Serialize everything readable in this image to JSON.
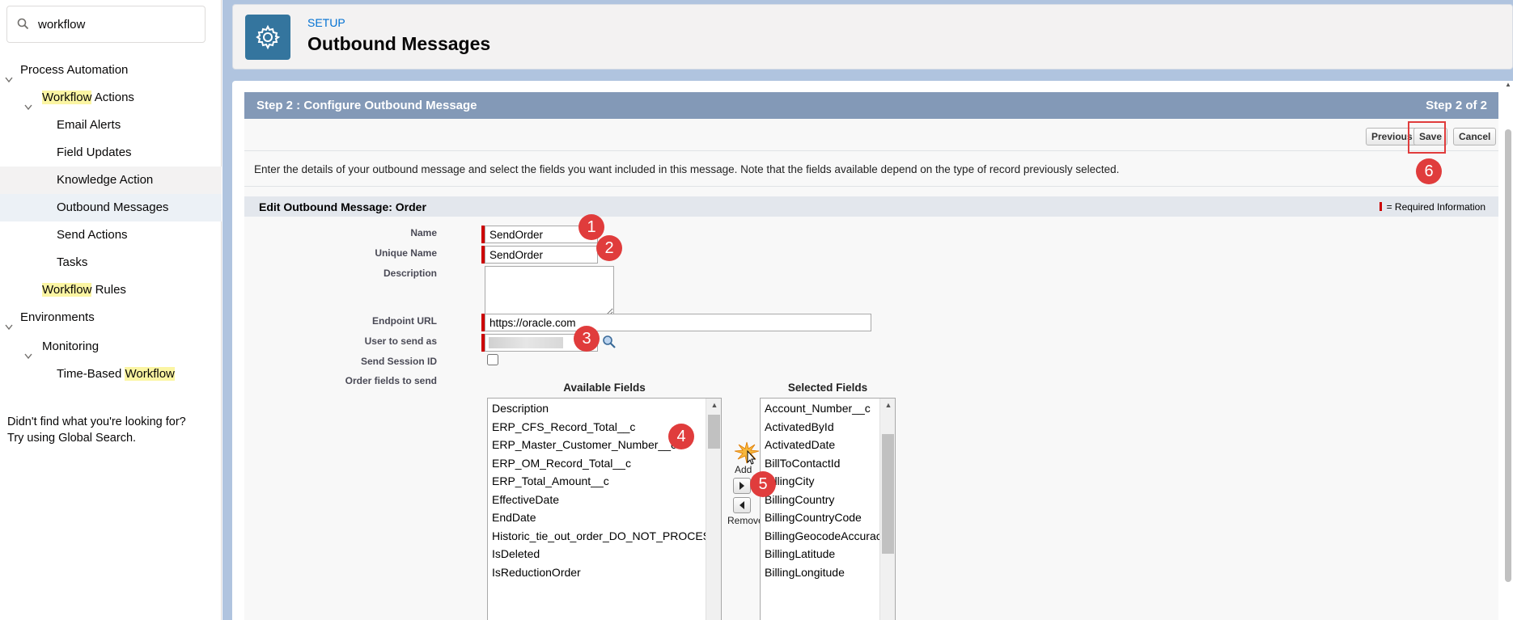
{
  "sidebar": {
    "search": {
      "value": "workflow"
    },
    "tree": [
      {
        "pre": "",
        "hl": "",
        "post": "Process Automation"
      },
      {
        "pre": "",
        "hl": "Workflow",
        "post": " Actions"
      },
      {
        "pre": "Email Alerts",
        "hl": "",
        "post": ""
      },
      {
        "pre": "Field Updates",
        "hl": "",
        "post": ""
      },
      {
        "pre": "Knowledge Action",
        "hl": "",
        "post": ""
      },
      {
        "pre": "Outbound Messages",
        "hl": "",
        "post": ""
      },
      {
        "pre": "Send Actions",
        "hl": "",
        "post": ""
      },
      {
        "pre": "Tasks",
        "hl": "",
        "post": ""
      },
      {
        "pre": "",
        "hl": "Workflow",
        "post": " Rules"
      },
      {
        "pre": "Environments",
        "hl": "",
        "post": ""
      },
      {
        "pre": "Monitoring",
        "hl": "",
        "post": ""
      },
      {
        "pre": "Time-Based ",
        "hl": "Workflow",
        "post": ""
      }
    ],
    "help_line1": "Didn't find what you're looking for?",
    "help_line2": "Try using Global Search."
  },
  "header": {
    "eyebrow": "SETUP",
    "title": "Outbound Messages",
    "icon": "gear-icon"
  },
  "step": {
    "title": "Step 2 : Configure Outbound Message",
    "count": "Step 2 of 2"
  },
  "buttons": {
    "previous": "Previous",
    "save": "Save",
    "cancel": "Cancel"
  },
  "intro": "Enter the details of your outbound message and select the fields you want included in this message. Note that the fields available depend on the type of record previously selected.",
  "section": {
    "title": "Edit Outbound Message: Order",
    "required_legend": "= Required Information"
  },
  "form": {
    "name_label": "Name",
    "name_value": "SendOrder",
    "unique_label": "Unique Name",
    "unique_value": "SendOrder",
    "description_label": "Description",
    "description_value": "",
    "endpoint_label": "Endpoint URL",
    "endpoint_value": "https://oracle.com",
    "user_label": "User to send as",
    "session_label": "Send Session ID",
    "fields_label": "Order fields to send"
  },
  "available": {
    "title": "Available Fields",
    "items": [
      "Description",
      "ERP_CFS_Record_Total__c",
      "ERP_Master_Customer_Number__c",
      "ERP_OM_Record_Total__c",
      "ERP_Total_Amount__c",
      "EffectiveDate",
      "EndDate",
      "Historic_tie_out_order_DO_NOT_PROCESS__c",
      "IsDeleted",
      "IsReductionOrder"
    ]
  },
  "selected": {
    "title": "Selected Fields",
    "items": [
      "Account_Number__c",
      "ActivatedById",
      "ActivatedDate",
      "BillToContactId",
      "BillingCity",
      "BillingCountry",
      "BillingCountryCode",
      "BillingGeocodeAccuracy",
      "BillingLatitude",
      "BillingLongitude"
    ]
  },
  "move": {
    "add": "Add",
    "remove": "Remove"
  },
  "badges": [
    "1",
    "2",
    "3",
    "4",
    "5",
    "6"
  ],
  "colors": {
    "accent": "#0070d2",
    "step_bar": "#8399b7",
    "required": "#cc0000",
    "badge": "#e03c3c",
    "highlight": "#fbf5a3"
  }
}
